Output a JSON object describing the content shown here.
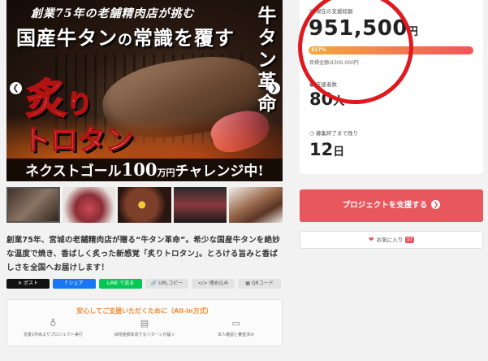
{
  "hero": {
    "tagline": "創業75年の老舗精肉店が挑む",
    "title_a": "国産牛タン",
    "title_b": "の",
    "title_c": "常識を覆す",
    "vertical_title": "牛タン革命",
    "big_line1_a": "炙",
    "big_line1_b": "り",
    "big_line2": "トロタン",
    "banner_a": "ネクストゴール",
    "banner_num": "100",
    "banner_unit": "万円",
    "banner_b": "チャレンジ中!",
    "prev_icon": "chevron-left-icon",
    "next_icon": "chevron-right-icon"
  },
  "description": "創業75年、宮城の老舗精肉店が贈る“牛タン革命”。希少な国産牛タンを絶妙な温度で焼き、香ばしく炙った新感覚「炙りトロタン」。とろける旨みと香ばしさを全国へお届けします！",
  "share": {
    "x": "✕ ポスト",
    "facebook": "f シェア",
    "line": "LINE で送る",
    "copy": "🔗 URLコピー",
    "embed": "</> 埋め込み",
    "qr": "▦ QRコード"
  },
  "safety": {
    "title": "安心してご支援いただくために（All-in方式）",
    "items": [
      {
        "icon": "money-bag-icon",
        "glyph": "♁",
        "label": "支援1件目よりプロジェクト実行"
      },
      {
        "icon": "document-icon",
        "glyph": "▤",
        "label": "目標金額未達でもリターンが届く"
      },
      {
        "icon": "id-card-icon",
        "glyph": "▭",
        "label": "本人確認と審査済み"
      }
    ]
  },
  "stats": {
    "raised_label": "現在の支援総額",
    "raised_amount": "951,500",
    "raised_unit": "円",
    "percent_label": "317%",
    "percent_value": 317,
    "target_text": "目標金額は300,000円",
    "supporters_label": "支援者数",
    "supporters_count": "80",
    "supporters_unit": "人",
    "days_label": "募集終了まで残り",
    "days_count": "12",
    "days_unit": "日"
  },
  "actions": {
    "support_label": "プロジェクトを支援する",
    "favorite_label": "お気に入り",
    "favorite_count": "57"
  },
  "colors": {
    "accent": "#e8575e",
    "highlight_circle": "#e0191e",
    "progress_start": "#f3a93e",
    "progress_end": "#f0555c"
  }
}
